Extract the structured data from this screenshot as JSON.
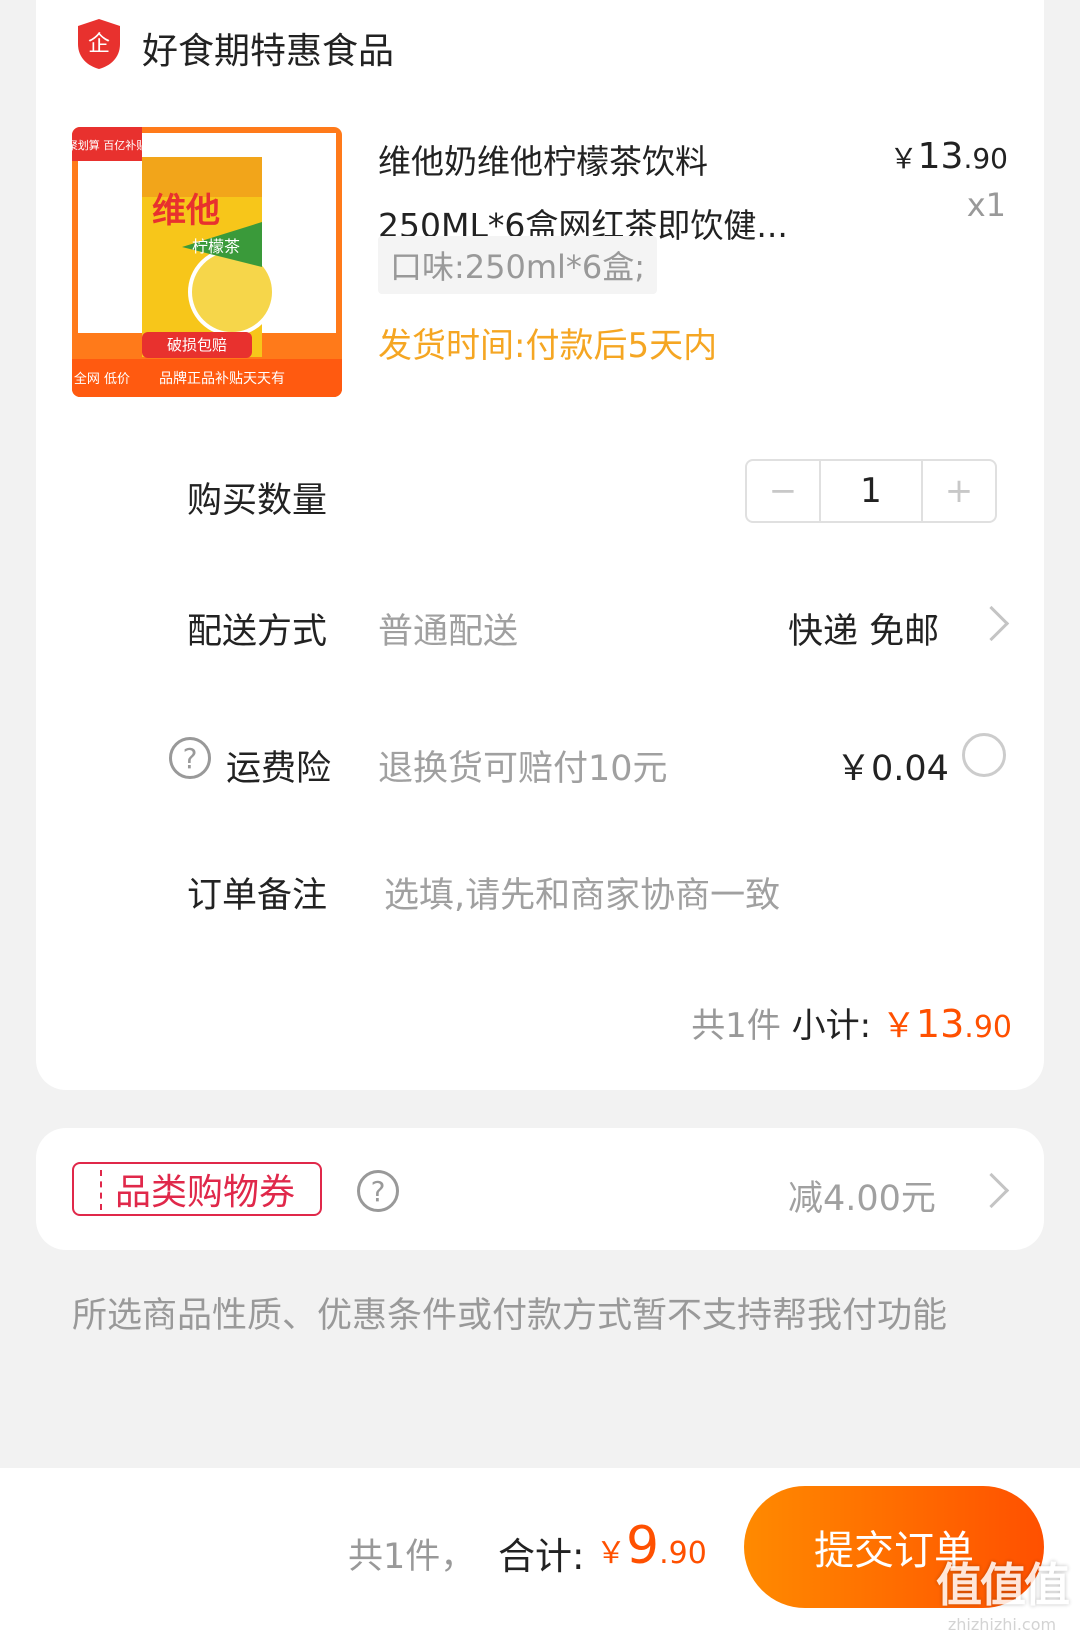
{
  "shop": {
    "name": "好食期特惠食品",
    "icon": "enterprise-shield-icon",
    "icon_char": "企"
  },
  "product": {
    "title": "维他奶维他柠檬茶饮料250ML*6盒网红茶即饮健...",
    "price_int": "13",
    "price_dec": ".90",
    "currency": "￥",
    "qty_text": "x1",
    "spec": "口味:250ml*6盒;",
    "ship_time": "发货时间:付款后5天内",
    "image": {
      "corner_badge": "聚划算 百亿补贴",
      "brand": "维他",
      "flavor": "柠檬茶",
      "damage_tag": "破损包赔",
      "bottom_left": "全网 低价",
      "bottom_text": "品牌正品补贴天天有"
    }
  },
  "quantity": {
    "label": "购买数量",
    "minus": "−",
    "value": "1",
    "plus": "+"
  },
  "delivery": {
    "label": "配送方式",
    "method": "普通配送",
    "value": "快递 免邮"
  },
  "insurance": {
    "label": "运费险",
    "help": "?",
    "desc": "退换货可赔付10元",
    "price": "￥0.04"
  },
  "remark": {
    "label": "订单备注",
    "placeholder": "选填,请先和商家协商一致"
  },
  "subtotal": {
    "count": "共1件",
    "label": "小计:",
    "currency": "￥",
    "price_int": "13",
    "price_dec": ".90"
  },
  "coupon": {
    "tag": "品类购物券",
    "help": "?",
    "value": "减4.00元"
  },
  "notice": "所选商品性质、优惠条件或付款方式暂不支持帮我付功能",
  "footer": {
    "count": "共1件，",
    "label": "合计:",
    "currency": "￥",
    "price_int": "9",
    "price_dec": ".90",
    "submit": "提交订单"
  },
  "watermark": {
    "big": "值值值",
    "small": "zhizhizhi.com"
  },
  "colors": {
    "accent": "#ff5000",
    "shipping": "#f5a623",
    "coupon": "#e0284a"
  }
}
